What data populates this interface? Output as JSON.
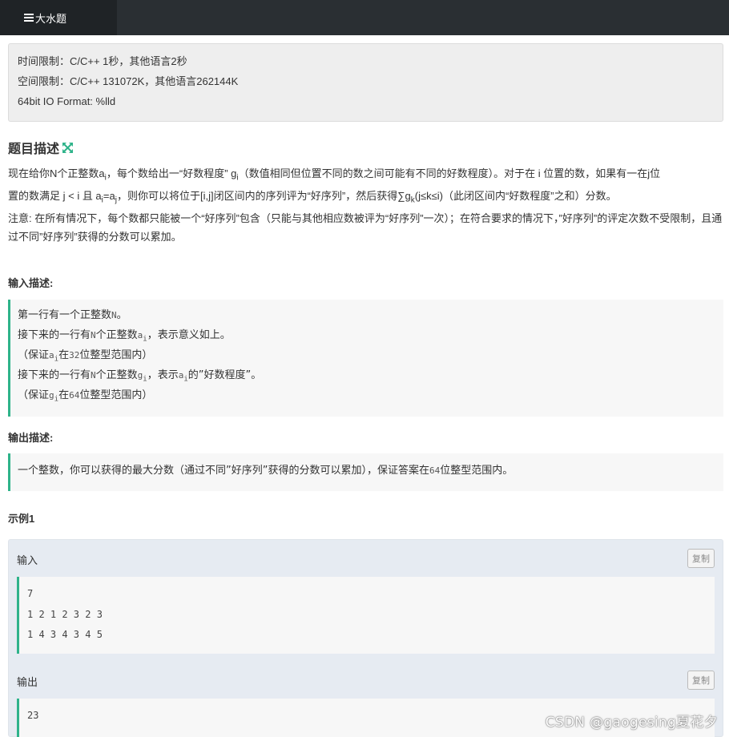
{
  "navbar": {
    "tab_label": "大水题",
    "tab_icon": "list-icon"
  },
  "limits": {
    "time": "时间限制：C/C++ 1秒，其他语言2秒",
    "space": "空间限制：C/C++ 131072K，其他语言262144K",
    "io_format": "64bit IO Format: %lld"
  },
  "problem": {
    "title": "题目描述",
    "expand_icon": "expand-icon",
    "desc_line1_a": "现在给你N个正整数a",
    "desc_line1_sub_i": "i",
    "desc_line1_b": "，每个数给出一“好数程度” g",
    "desc_line1_sub_i2": "i",
    "desc_line1_c": "（数值相同但位置不同的数之间可能有不同的好数程度）。对于在 i 位置的数，如果有一在j位",
    "desc_line2_a": "置的数满足 j < i 且 a",
    "desc_line2_sub_i": "i",
    "desc_line2_b": "=a",
    "desc_line2_sub_j": "j",
    "desc_line2_c": "，则你可以将位于[i,j]闭区间内的序列评为“好序列”，然后获得∑g",
    "desc_line2_sub_k": "k",
    "desc_line2_d": "(j≤k≤i)（此闭区间内“好数程度”之和）分数。",
    "note": "注意: 在所有情况下，每个数都只能被一个“好序列”包含（只能与其他相应数被评为“好序列”一次）；在符合要求的情况下，”好序列”的评定次数不受限制，且通过不同”好序列”获得的分数可以累加。"
  },
  "input_section": {
    "label": "输入描述:",
    "l1_a": "第一行有一个正整数",
    "l1_m": "N",
    "l1_b": "。",
    "l2_a": "接下来的一行有",
    "l2_m": "N",
    "l2_b": "个正整数",
    "l2_m2": "a",
    "l2_s": "i",
    "l2_c": "，表示意义如上。",
    "l3_a": "（保证",
    "l3_m": "a",
    "l3_s": "i",
    "l3_b": "在",
    "l3_m2": "32",
    "l3_c": "位整型范围内）",
    "l4_a": "接下来的一行有",
    "l4_m": "N",
    "l4_b": "个正整数",
    "l4_m2": "g",
    "l4_s": "i",
    "l4_c": "，表示",
    "l4_m3": "a",
    "l4_s2": "i",
    "l4_d": "的”好数程度”。",
    "l5_a": "（保证",
    "l5_m": "g",
    "l5_s": "i",
    "l5_b": "在",
    "l5_m2": "64",
    "l5_c": "位整型范围内）"
  },
  "output_section": {
    "label": "输出描述:",
    "l1_a": "一个整数，你可以获得的最大分数（通过不同”好序列”获得的分数可以累加），保证答案在",
    "l1_m": "64",
    "l1_b": "位整型范围内。"
  },
  "example": {
    "title": "示例1",
    "input_label": "输入",
    "output_label": "输出",
    "copy_label": "复制",
    "input_lines": [
      "7",
      "1 2 1 2 3 2 3",
      "1 4 3 4 3 4 5"
    ],
    "output_lines": [
      "23"
    ]
  },
  "watermark": "CSDN @gaogesing夏花夕"
}
